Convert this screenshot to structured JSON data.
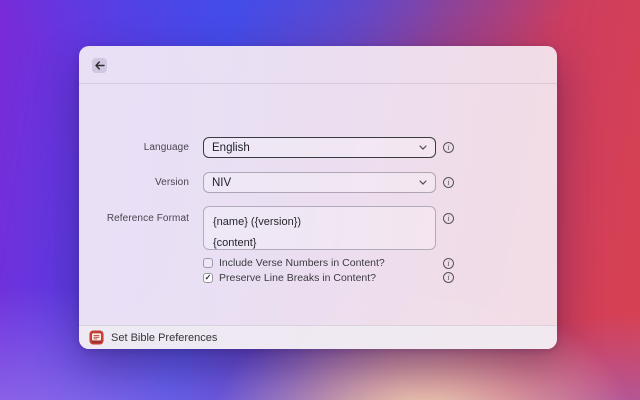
{
  "window": {
    "header": {
      "back_icon": "arrow-left-icon"
    },
    "form": {
      "fields": [
        {
          "label": "Language",
          "type": "dropdown",
          "value": "English",
          "focused": true
        },
        {
          "label": "Version",
          "type": "dropdown",
          "value": "NIV",
          "focused": false
        },
        {
          "label": "Reference Format",
          "type": "textarea",
          "lines": [
            "{name} ({version})",
            "{content}"
          ]
        }
      ],
      "checkboxes": [
        {
          "label": "Include Verse Numbers in Content?",
          "checked": false,
          "mark": ""
        },
        {
          "label": "Preserve Line Breaks in Content?",
          "checked": true,
          "mark": "✓"
        }
      ],
      "info_icon": "info-circle-icon",
      "chevron_icon": "chevron-down-icon"
    },
    "footer": {
      "title": "Set Bible Preferences",
      "icon": "bible-book-icon"
    }
  },
  "colors": {
    "focus_border": "#3a3a41",
    "app_icon_red": "#c63d38",
    "bg_purple": "#7a2ad8",
    "bg_blue": "#4649e6",
    "bg_red": "#d94150",
    "bg_glow": "#f8e2bc"
  }
}
